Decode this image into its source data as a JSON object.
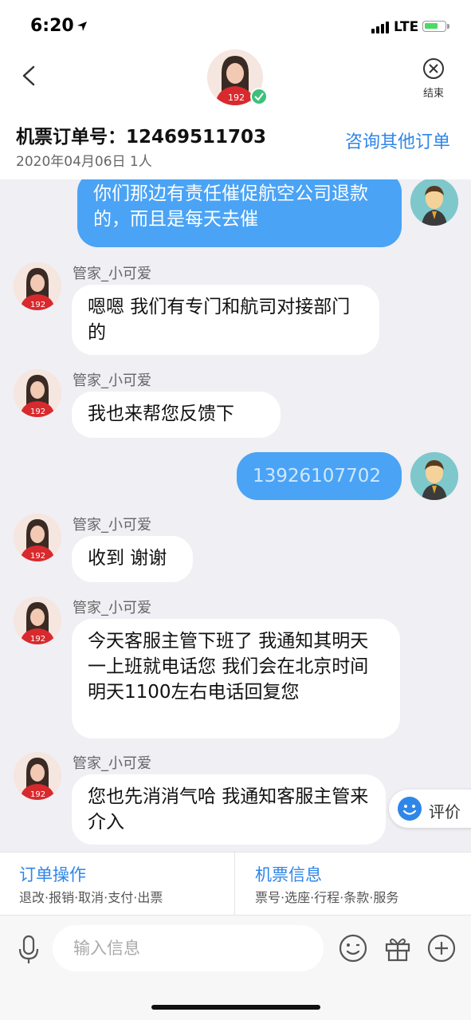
{
  "status_bar": {
    "time": "6:20",
    "network": "LTE",
    "battery_level": 0.65
  },
  "header": {
    "end_label": "结束",
    "order_title": "机票订单号：12469511703",
    "order_sub": "2020年04月06日 1人",
    "consult_link": "咨询其他订单"
  },
  "messages": [
    {
      "from": "user",
      "text": "你们那边有责任催促航空公司退款的，而且是每天去催"
    },
    {
      "from": "agent",
      "sender": "管家_小可爱",
      "text": "嗯嗯 我们有专门和航司对接部门的"
    },
    {
      "from": "agent",
      "sender": "管家_小可爱",
      "text": "我也来帮您反馈下"
    },
    {
      "from": "user",
      "text": "13926107702"
    },
    {
      "from": "agent",
      "sender": "管家_小可爱",
      "text": "收到 谢谢"
    },
    {
      "from": "agent",
      "sender": "管家_小可爱",
      "text": "今天客服主管下班了 我通知其明天一上班就电话您 我们会在北京时间明天1100左右电话回复您"
    },
    {
      "from": "agent",
      "sender": "管家_小可爱",
      "text": "您也先消消气哈 我通知客服主管来介入"
    }
  ],
  "rate_button": {
    "label": "评价"
  },
  "ops": {
    "order_ops": {
      "title": "订单操作",
      "sub": "退改·报销·取消·支付·出票"
    },
    "ticket_info": {
      "title": "机票信息",
      "sub": "票号·选座·行程·条款·服务"
    }
  },
  "input": {
    "placeholder": "输入信息"
  },
  "colors": {
    "accent": "#2f86e8",
    "user_bubble": "#4aa3f5",
    "chat_bg": "#efeff4"
  }
}
